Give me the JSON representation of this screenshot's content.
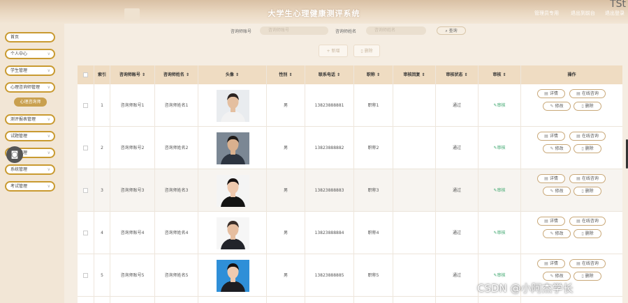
{
  "header": {
    "title": "大学生心理健康测评系统",
    "links": [
      "管理员专用",
      "退出到前台",
      "退出登录"
    ],
    "corner_text": "TSt"
  },
  "sidebar": {
    "items": [
      {
        "label": "首页",
        "has_chevron": false
      },
      {
        "label": "个人中心",
        "has_chevron": true
      },
      {
        "label": "学生管理",
        "has_chevron": true
      },
      {
        "label": "心理咨询师管理",
        "has_chevron": true
      },
      {
        "label": "测评报表管理",
        "has_chevron": true
      },
      {
        "label": "试题管理",
        "has_chevron": true
      },
      {
        "label": "测试管理",
        "has_chevron": true
      },
      {
        "label": "系统管理",
        "has_chevron": true
      },
      {
        "label": "考试管理",
        "has_chevron": true
      }
    ],
    "active_sub": "心理咨询师"
  },
  "search": {
    "account_label": "咨询师账号",
    "account_placeholder": "咨询师账号",
    "name_label": "咨询师姓名",
    "name_placeholder": "咨询师姓名",
    "button": "查询"
  },
  "actions": {
    "add": "新增",
    "delete": "删除"
  },
  "table": {
    "headers": [
      "索引",
      "咨询师账号",
      "咨询师姓名",
      "头像",
      "性别",
      "联系电话",
      "职称",
      "审核回复",
      "审核状态",
      "审核",
      "操作"
    ],
    "rows": [
      {
        "index": "1",
        "account": "咨询师账号1",
        "name": "咨询师姓名1",
        "gender": "男",
        "phone": "13823888881",
        "title": "职称1",
        "reply": "",
        "status": "通过",
        "audit": "审核"
      },
      {
        "index": "2",
        "account": "咨询师账号2",
        "name": "咨询师姓名2",
        "gender": "男",
        "phone": "13823888882",
        "title": "职称2",
        "reply": "",
        "status": "通过",
        "audit": "审核"
      },
      {
        "index": "3",
        "account": "咨询师账号3",
        "name": "咨询师姓名3",
        "gender": "男",
        "phone": "13823888883",
        "title": "职称3",
        "reply": "",
        "status": "通过",
        "audit": "审核"
      },
      {
        "index": "4",
        "account": "咨询师账号4",
        "name": "咨询师姓名4",
        "gender": "男",
        "phone": "13823888884",
        "title": "职称4",
        "reply": "",
        "status": "通过",
        "audit": "审核"
      },
      {
        "index": "5",
        "account": "咨询师账号5",
        "name": "咨询师姓名5",
        "gender": "男",
        "phone": "13823888885",
        "title": "职称5",
        "reply": "",
        "status": "通过",
        "audit": "审核"
      }
    ],
    "op_labels": {
      "detail": "详情",
      "consult": "在线咨询",
      "edit": "修改",
      "delete": "删除"
    }
  },
  "watermark": "CSDN @小阿杰学长",
  "icons": [
    "camera-icon",
    "search-icon",
    "plus-icon",
    "trash-icon",
    "edit-icon",
    "detail-icon",
    "chevron-down-icon",
    "sort-icon"
  ],
  "colors": {
    "accent": "#c99a30",
    "header_bg": "#efdcc2",
    "audit_green": "#3aa56b"
  }
}
